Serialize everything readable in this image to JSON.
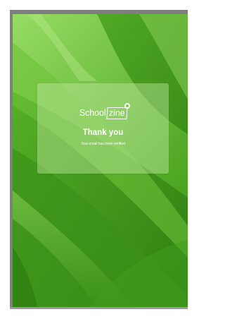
{
  "brand": {
    "logo_text_left": "School",
    "logo_text_boxed": "zine"
  },
  "message": {
    "title": "Thank you",
    "subtitle": "Your email has been verified"
  },
  "colors": {
    "background_green": "#4ea624",
    "card_overlay": "#c8ebaa",
    "frame_border": "#7e7e7e",
    "text": "#ffffff"
  }
}
